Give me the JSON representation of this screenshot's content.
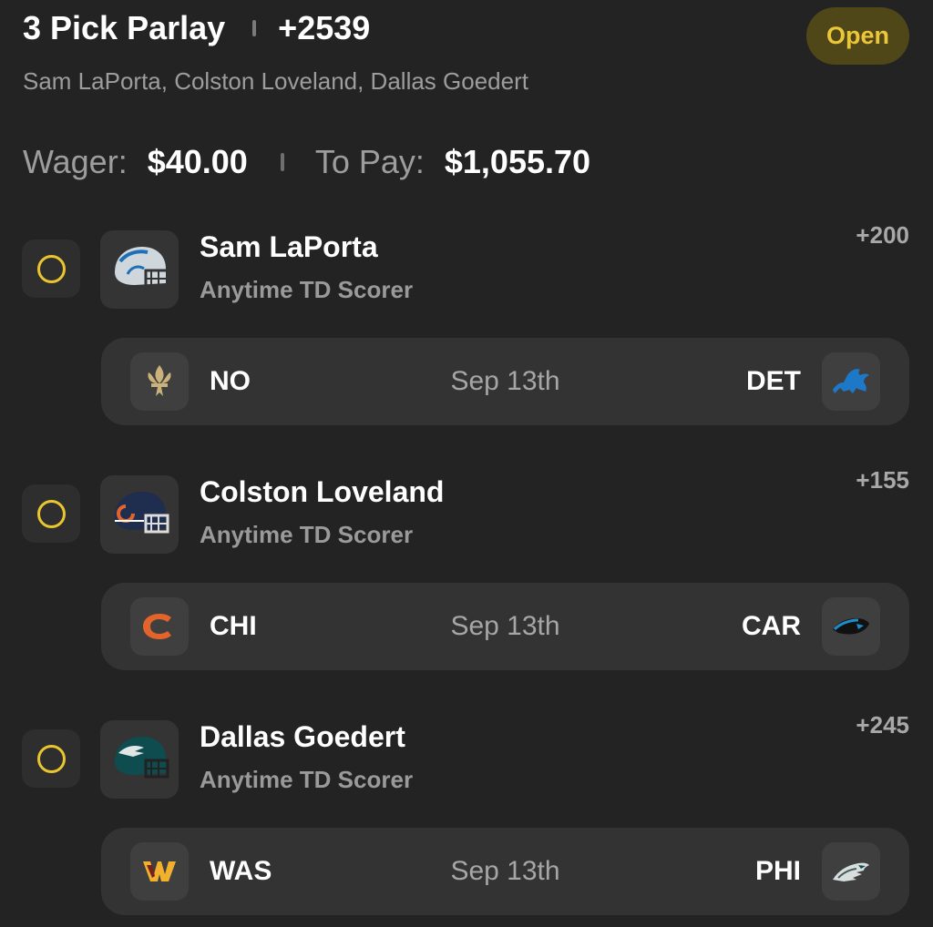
{
  "header": {
    "title": "3 Pick Parlay",
    "odds": "+2539",
    "status": "Open",
    "players_summary": "Sam LaPorta, Colston Loveland, Dallas Goedert"
  },
  "wager": {
    "wager_label": "Wager:",
    "wager_value": "$40.00",
    "payout_label": "To Pay:",
    "payout_value": "$1,055.70"
  },
  "picks": [
    {
      "player": "Sam LaPorta",
      "market": "Anytime TD Scorer",
      "odds": "+200",
      "helmet_icon": "lions-helmet-icon",
      "game": {
        "away_team": "NO",
        "away_icon": "saints-fleur-de-lis-icon",
        "date": "Sep 13th",
        "home_team": "DET",
        "home_icon": "lions-logo-icon"
      }
    },
    {
      "player": "Colston Loveland",
      "market": "Anytime TD Scorer",
      "odds": "+155",
      "helmet_icon": "bears-helmet-icon",
      "game": {
        "away_team": "CHI",
        "away_icon": "bears-c-logo-icon",
        "date": "Sep 13th",
        "home_team": "CAR",
        "home_icon": "panthers-logo-icon"
      }
    },
    {
      "player": "Dallas Goedert",
      "market": "Anytime TD Scorer",
      "odds": "+245",
      "helmet_icon": "eagles-helmet-icon",
      "game": {
        "away_team": "WAS",
        "away_icon": "commanders-w-logo-icon",
        "date": "Sep 13th",
        "home_team": "PHI",
        "home_icon": "eagles-logo-icon"
      }
    }
  ],
  "colors": {
    "background": "#232323",
    "card": "#333333",
    "accent_yellow": "#e9c52f",
    "status_bg": "#4f4717",
    "muted_text": "#9d9d9d"
  }
}
